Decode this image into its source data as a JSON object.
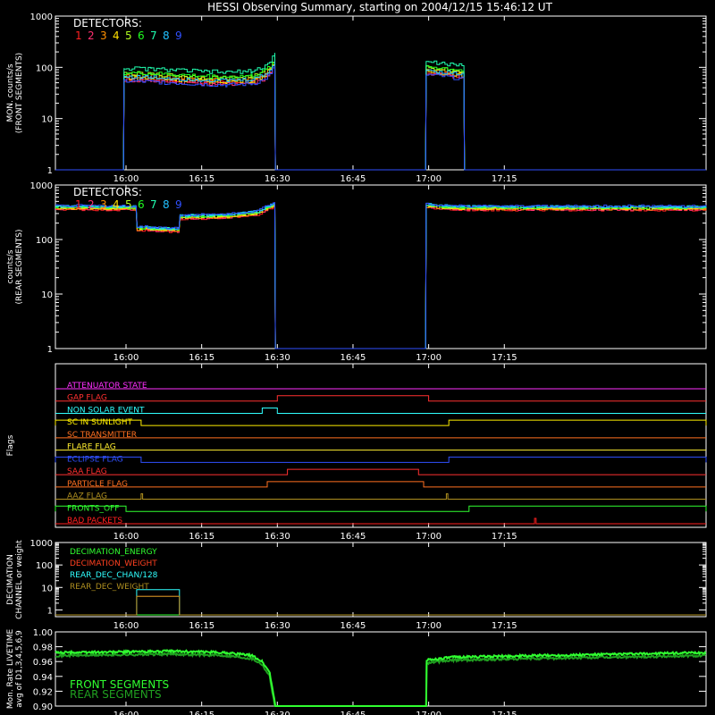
{
  "title": "HESSI Observing Summary, starting on 2004/12/15 15:46:12 UT",
  "time_ticks": [
    "16:00",
    "16:15",
    "16:30",
    "16:45",
    "17:00",
    "17:15"
  ],
  "chart_data": [
    {
      "type": "line",
      "id": "front",
      "ylabel": [
        "MON. counts/s",
        "(FRONT SEGMENTS)"
      ],
      "yscale": "log",
      "ylim": [
        1,
        1000
      ],
      "yticks": [
        "1",
        "10",
        "100",
        "1000"
      ],
      "legend_title": "DETECTORS:",
      "legend_items": [
        "1",
        "2",
        "3",
        "4",
        "5",
        "6",
        "7",
        "8",
        "9"
      ],
      "colors": [
        "#ff2020",
        "#ff3070",
        "#ff9000",
        "#ffe000",
        "#b0ff20",
        "#20ff20",
        "#20ffb0",
        "#20c0ff",
        "#3050ff"
      ],
      "base_series": {
        "name": "",
        "time": [
          "15:46",
          "15:59.5",
          "15:59.6",
          "16:05",
          "16:10",
          "16:15",
          "16:20",
          "16:25",
          "16:27",
          "16:28.5",
          "16:29.5",
          "16:29.6",
          "16:59.4",
          "16:59.5",
          "17:05",
          "17:07",
          "17:07.1",
          "17:55"
        ],
        "values": [
          1,
          1,
          60,
          58,
          55,
          52,
          50,
          53,
          62,
          80,
          120,
          1,
          1,
          80,
          70,
          65,
          1,
          1
        ]
      },
      "detector_factors": [
        1.0,
        0.95,
        1.15,
        1.05,
        1.25,
        1.3,
        1.6,
        1.1,
        0.9
      ]
    },
    {
      "type": "line",
      "id": "rear",
      "ylabel": [
        "counts/s",
        "(REAR SEGMENTS)"
      ],
      "yscale": "log",
      "ylim": [
        1,
        1000
      ],
      "yticks": [
        "1",
        "10",
        "100",
        "1000"
      ],
      "legend_title": "DETECTORS:",
      "legend_items": [
        "1",
        "2",
        "3",
        "4",
        "5",
        "6",
        "7",
        "8",
        "9"
      ],
      "base_series": {
        "name": "",
        "time": [
          "15:46",
          "16:02",
          "16:02.2",
          "16:10.5",
          "16:10.7",
          "16:20",
          "16:26",
          "16:29.5",
          "16:29.6",
          "16:59.4",
          "16:59.5",
          "17:05",
          "17:55"
        ],
        "values": [
          390,
          380,
          160,
          150,
          260,
          270,
          310,
          450,
          1,
          1,
          420,
          380,
          380
        ]
      }
    },
    {
      "type": "table",
      "id": "flags",
      "ylabel": "Flags",
      "flags": [
        {
          "name": "ATTENUATOR STATE",
          "color": "#ff30ff",
          "on": []
        },
        {
          "name": "GAP FLAG",
          "color": "#ff3030",
          "on": [
            [
              "16:30",
              "17:00"
            ]
          ]
        },
        {
          "name": "NON SOLAR EVENT",
          "color": "#30ffff",
          "on": [
            [
              "16:27",
              "16:30"
            ]
          ]
        },
        {
          "name": "SC IN SUNLIGHT",
          "color": "#ffee00",
          "on": [
            [
              "15:46",
              "16:03"
            ],
            [
              "17:04",
              "17:55"
            ]
          ]
        },
        {
          "name": "SC TRANSMITTER",
          "color": "#ff7020",
          "on": []
        },
        {
          "name": "FLARE FLAG",
          "color": "#ffee30",
          "on": []
        },
        {
          "name": "ECLIPSE FLAG",
          "color": "#3050ff",
          "on": [
            [
              "15:46",
              "16:03"
            ],
            [
              "17:04",
              "17:55"
            ]
          ]
        },
        {
          "name": "SAA FLAG",
          "color": "#ff3030",
          "on": [
            [
              "16:32",
              "16:58"
            ]
          ]
        },
        {
          "name": "PARTICLE FLAG",
          "color": "#ff7020",
          "on": [
            [
              "16:28",
              "16:59"
            ]
          ]
        },
        {
          "name": "AAZ FLAG",
          "color": "#b09020",
          "on": [
            [
              "16:03",
              "16:03.3"
            ],
            [
              "17:03.5",
              "17:03.8"
            ]
          ]
        },
        {
          "name": "FRONTS_OFF",
          "color": "#30ff30",
          "on": [
            [
              "15:46",
              "15:60"
            ],
            [
              "17:08",
              "17:55"
            ]
          ]
        },
        {
          "name": "BAD PACKETS",
          "color": "#ff2020",
          "on": [
            [
              "17:21",
              "17:21.3"
            ]
          ]
        }
      ]
    },
    {
      "type": "line",
      "id": "decimation",
      "ylabel": [
        "DECIMATION",
        "CHANNEL or weight"
      ],
      "yscale": "log",
      "ylim": [
        0.5,
        1000
      ],
      "yticks": [
        "1",
        "10",
        "100",
        "1000"
      ],
      "series": [
        {
          "name": "DECIMATION_ENERGY",
          "color": "#30ff30",
          "time": [
            "15:46",
            "17:55"
          ],
          "values": [
            0.6,
            0.6
          ]
        },
        {
          "name": "DECIMATION_WEIGHT",
          "color": "#ff4020",
          "time": [
            "15:46",
            "16:02",
            "16:02.1",
            "16:10.5",
            "16:10.6",
            "17:55"
          ],
          "values": [
            0.6,
            0.6,
            4,
            4,
            0.6,
            0.6
          ]
        },
        {
          "name": "REAR_DEC_CHAN/128",
          "color": "#30ffff",
          "time": [
            "15:46",
            "16:02",
            "16:02.1",
            "16:10.5",
            "16:10.6",
            "17:55"
          ],
          "values": [
            0.6,
            0.6,
            8,
            8,
            0.6,
            0.6
          ]
        },
        {
          "name": "REAR_DEC_WEIGHT",
          "color": "#b09020",
          "time": [
            "15:46",
            "16:02",
            "16:02.1",
            "16:10.5",
            "16:10.6",
            "17:55"
          ],
          "values": [
            0.6,
            0.6,
            4,
            4,
            0.6,
            0.6
          ]
        }
      ]
    },
    {
      "type": "line",
      "id": "livetime",
      "ylabel": [
        "Mon. Rate LIVETIME",
        "avg of D1,3,4,5,6,9"
      ],
      "yscale": "linear",
      "ylim": [
        0.9,
        1.0
      ],
      "yticks": [
        "0.90",
        "0.92",
        "0.94",
        "0.96",
        "0.98",
        "1.00"
      ],
      "series": [
        {
          "name": "FRONT SEGMENTS",
          "color": "#30ff30",
          "time": [
            "15:46",
            "16:10",
            "16:20",
            "16:25",
            "16:27",
            "16:28.5",
            "16:29.5",
            "16:29.6",
            "16:59.5",
            "16:59.6",
            "17:05",
            "17:55"
          ],
          "values": [
            0.972,
            0.974,
            0.972,
            0.968,
            0.96,
            0.945,
            0.905,
            0.9,
            0.9,
            0.962,
            0.966,
            0.972
          ]
        },
        {
          "name": "REAR SEGMENTS",
          "color": "#20a020",
          "time": [
            "15:46",
            "16:10",
            "16:20",
            "16:25",
            "16:27",
            "16:28.5",
            "16:29.5",
            "16:29.6",
            "16:59.5",
            "16:59.6",
            "17:05",
            "17:55"
          ],
          "values": [
            0.968,
            0.97,
            0.968,
            0.964,
            0.956,
            0.94,
            0.9,
            0.9,
            0.9,
            0.958,
            0.962,
            0.968
          ]
        }
      ]
    }
  ]
}
